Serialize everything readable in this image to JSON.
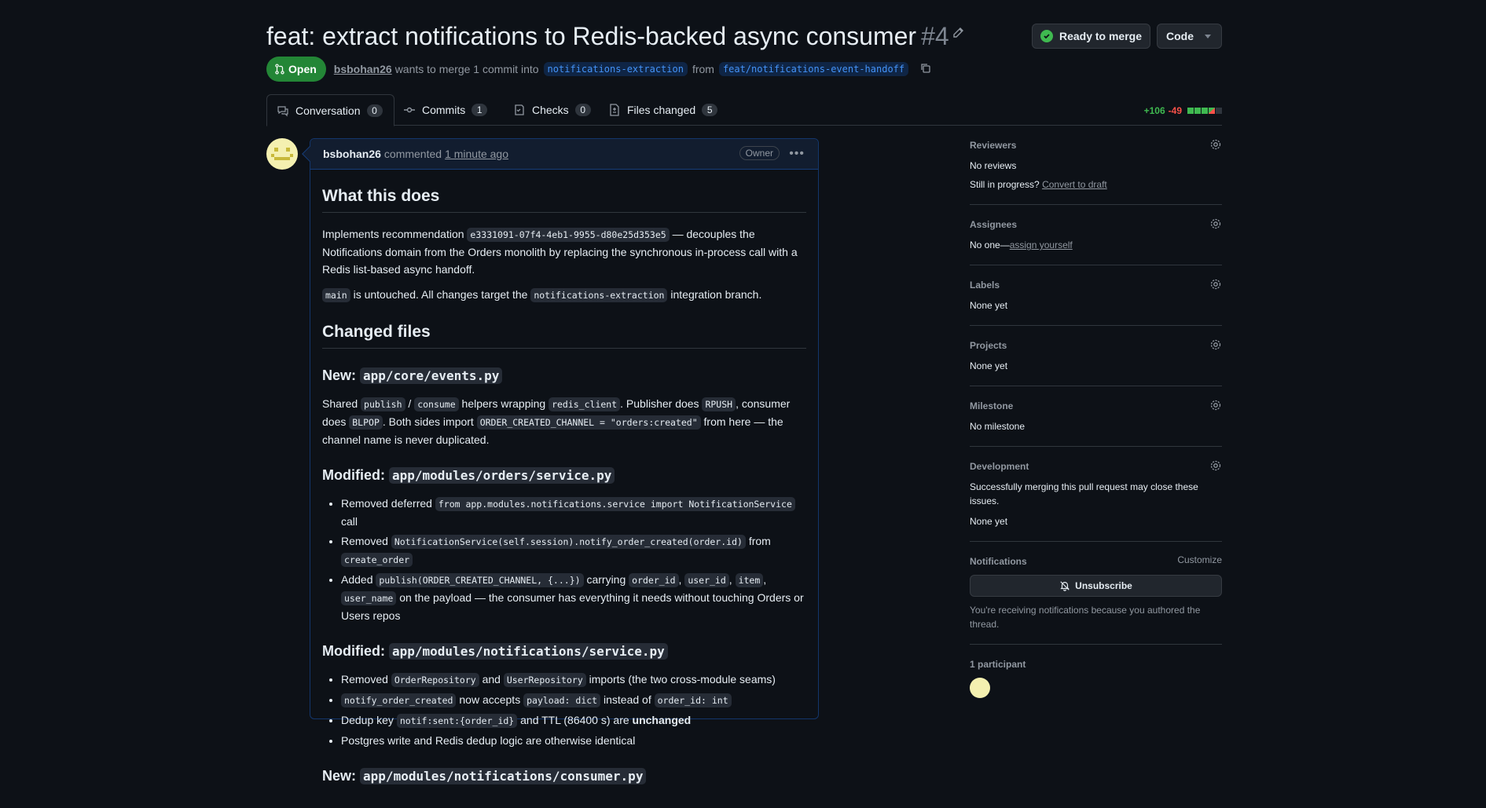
{
  "header": {
    "title": "feat: extract notifications to Redis-backed async consumer",
    "number": "#4",
    "ready_label": "Ready to merge",
    "code_label": "Code",
    "state": "Open",
    "author": "bsbohan26",
    "merge_text_1": "wants to merge 1 commit into",
    "base_branch": "notifications-extraction",
    "merge_text_2": "from",
    "head_branch": "feat/notifications-event-handoff"
  },
  "tabs": [
    {
      "label": "Conversation",
      "count": "0"
    },
    {
      "label": "Commits",
      "count": "1"
    },
    {
      "label": "Checks",
      "count": "0"
    },
    {
      "label": "Files changed",
      "count": "5"
    }
  ],
  "diffstat": {
    "additions": "+106",
    "deletions": "-49"
  },
  "comment": {
    "author": "bsbohan26",
    "action": "commented",
    "time": "1 minute ago",
    "badge": "Owner",
    "h_what": "What this does",
    "p1_a": "Implements recommendation",
    "p1_code": "e3331091-07f4-4eb1-9955-d80e25d353e5",
    "p1_b": "— decouples the Notifications domain from the Orders monolith by replacing the synchronous in-process call with a Redis list-based async handoff.",
    "p2_code1": "main",
    "p2_a": "is untouched. All changes target the",
    "p2_code2": "notifications-extraction",
    "p2_b": "integration branch.",
    "h_changed": "Changed files",
    "s1_label": "New:",
    "s1_file": "app/core/events.py",
    "s1_t1": "Shared",
    "s1_c1": "publish",
    "s1_t2": "/",
    "s1_c2": "consume",
    "s1_t3": "helpers wrapping",
    "s1_c3": "redis_client",
    "s1_t4": ". Publisher does",
    "s1_c4": "RPUSH",
    "s1_t5": ", consumer does",
    "s1_c5": "BLPOP",
    "s1_t6": ". Both sides import",
    "s1_c6": "ORDER_CREATED_CHANNEL = \"orders:created\"",
    "s1_t7": "from here — the channel name is never duplicated.",
    "s2_label": "Modified:",
    "s2_file": "app/modules/orders/service.py",
    "s2_b1_t1": "Removed deferred",
    "s2_b1_c1": "from app.modules.notifications.service import NotificationService",
    "s2_b1_t2": "call",
    "s2_b2_t1": "Removed",
    "s2_b2_c1": "NotificationService(self.session).notify_order_created(order.id)",
    "s2_b2_t2": "from",
    "s2_b2_c2": "create_order",
    "s2_b3_t1": "Added",
    "s2_b3_c1": "publish(ORDER_CREATED_CHANNEL, {...})",
    "s2_b3_t2": "carrying",
    "s2_b3_c2": "order_id",
    "s2_b3_c3": "user_id",
    "s2_b3_c4": "item",
    "s2_b3_c5": "user_name",
    "s2_b3_t3": "on the payload — the consumer has everything it needs without touching Orders or Users repos",
    "s3_label": "Modified:",
    "s3_file": "app/modules/notifications/service.py",
    "s3_b1_t1": "Removed",
    "s3_b1_c1": "OrderRepository",
    "s3_b1_t2": "and",
    "s3_b1_c2": "UserRepository",
    "s3_b1_t3": "imports (the two cross-module seams)",
    "s3_b2_c1": "notify_order_created",
    "s3_b2_t1": "now accepts",
    "s3_b2_c2": "payload: dict",
    "s3_b2_t2": "instead of",
    "s3_b2_c3": "order_id: int",
    "s3_b3_t1": "Dedup key",
    "s3_b3_c1": "notif:sent:{order_id}",
    "s3_b3_t2": "and TTL (86400 s) are",
    "s3_b3_bold": "unchanged",
    "s3_b4": "Postgres write and Redis dedup logic are otherwise identical",
    "s4_label": "New:",
    "s4_file": "app/modules/notifications/consumer.py"
  },
  "sidebar": {
    "reviewers_title": "Reviewers",
    "reviewers_value": "No reviews",
    "in_progress": "Still in progress?",
    "convert_draft": "Convert to draft",
    "assignees_title": "Assignees",
    "assignees_value": "No one—",
    "assign_yourself": "assign yourself",
    "labels_title": "Labels",
    "labels_value": "None yet",
    "projects_title": "Projects",
    "projects_value": "None yet",
    "milestone_title": "Milestone",
    "milestone_value": "No milestone",
    "development_title": "Development",
    "development_text": "Successfully merging this pull request may close these issues.",
    "development_value": "None yet",
    "notifications_title": "Notifications",
    "customize": "Customize",
    "unsubscribe": "Unsubscribe",
    "notif_reason": "You're receiving notifications because you authored the thread.",
    "participants": "1 participant"
  },
  "colors": {
    "open": "#238636",
    "additions": "#3fb950",
    "deletions": "#f85149",
    "link": "#4493f8"
  }
}
